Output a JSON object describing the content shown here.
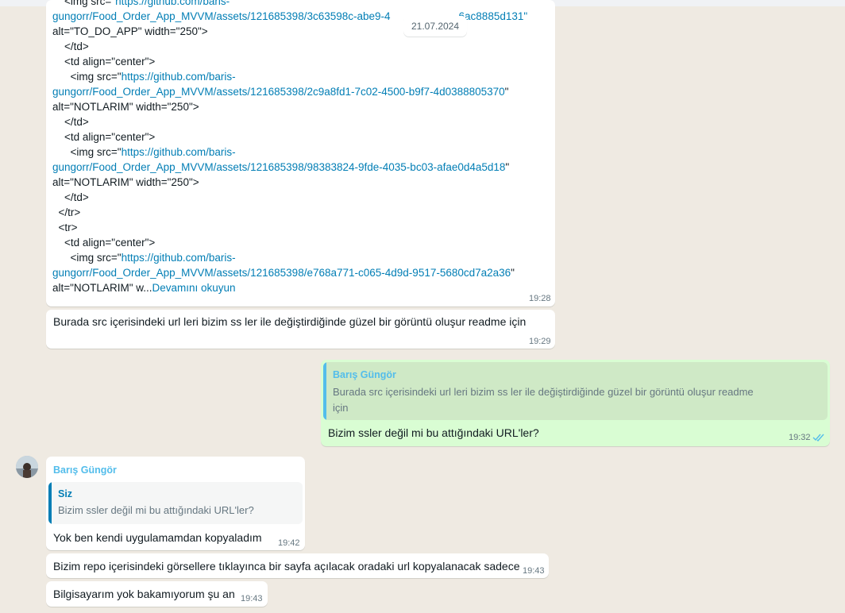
{
  "date_separator": "21.07.2024",
  "code_message": {
    "lines": [
      {
        "pre": "    <img src=\"",
        "link": "https://github.com/baris-",
        "post": ""
      },
      {
        "pre": "",
        "link": "gungorr/Food_Order_App_MVVM/assets/121685398/3c63598c-abe9-4",
        "post": "",
        "hidden_tail_link": "6ac8885d131\""
      },
      {
        "pre": "alt=\"TO_DO_APP\" width=\"250\">",
        "link": "",
        "post": ""
      },
      {
        "pre": "    </td>",
        "link": "",
        "post": ""
      },
      {
        "pre": "    <td align=\"center\">",
        "link": "",
        "post": ""
      },
      {
        "pre": "      <img src=\"",
        "link": "https://github.com/baris-",
        "post": ""
      },
      {
        "pre": "",
        "link": "gungorr/Food_Order_App_MVVM/assets/121685398/2c9a8fd1-7c02-4500-b9f7-4d0388805370",
        "post": "\""
      },
      {
        "pre": "alt=\"NOTLARIM\" width=\"250\">",
        "link": "",
        "post": ""
      },
      {
        "pre": "    </td>",
        "link": "",
        "post": ""
      },
      {
        "pre": "    <td align=\"center\">",
        "link": "",
        "post": ""
      },
      {
        "pre": "      <img src=\"",
        "link": "https://github.com/baris-",
        "post": ""
      },
      {
        "pre": "",
        "link": "gungorr/Food_Order_App_MVVM/assets/121685398/98383824-9fde-4035-bc03-afae0d4a5d18",
        "post": "\""
      },
      {
        "pre": "alt=\"NOTLARIM\" width=\"250\">",
        "link": "",
        "post": ""
      },
      {
        "pre": "    </td>",
        "link": "",
        "post": ""
      },
      {
        "pre": "  </tr>",
        "link": "",
        "post": ""
      },
      {
        "pre": "  <tr>",
        "link": "",
        "post": ""
      },
      {
        "pre": "    <td align=\"center\">",
        "link": "",
        "post": ""
      },
      {
        "pre": "      <img src=\"",
        "link": "https://github.com/baris-",
        "post": ""
      },
      {
        "pre": "",
        "link": "gungorr/Food_Order_App_MVVM/assets/121685398/e768a771-c065-4d9d-9517-5680cd7a2a36",
        "post": "\""
      },
      {
        "pre": "alt=\"NOTLARIM\" w...",
        "link": "",
        "post": ""
      }
    ],
    "read_more": "Devamını okuyun",
    "time": "19:28"
  },
  "msg_burada": {
    "text": "Burada src içerisindeki url leri bizim ss ler ile değiştirdiğinde güzel bir görüntü oluşur readme  için",
    "time": "19:29"
  },
  "reply_out": {
    "quote_author": "Barış Güngör",
    "quote_text_line1": "Burada src içerisindeki url leri bizim ss ler ile değiştirdiğinde güzel bir görüntü oluşur readme",
    "quote_text_line2": "için",
    "text": "Bizim ssler değil mi bu attığındaki URL'ler?",
    "time": "19:32"
  },
  "reply_in": {
    "sender": "Barış Güngör",
    "quote_author": "Siz",
    "quote_text": "Bizim ssler değil mi bu attığındaki URL'ler?",
    "text": "Yok ben kendi uygulamamdan kopyaladım",
    "time": "19:42"
  },
  "msg_repo": {
    "text": "Bizim repo içerisindeki görsellere tıklayınca bir sayfa açılacak oradaki url kopyalanacak sadece",
    "time": "19:43"
  },
  "msg_bilgisayar": {
    "text": "Bilgisayarım yok bakamıyorum şu an",
    "time": "19:43"
  },
  "colors": {
    "background": "#efeae2",
    "incoming": "#ffffff",
    "outgoing": "#d9fdd3",
    "link": "#027eb5",
    "quote_bar_in": "#06cf9c",
    "sender_name": "#53bdeb",
    "tick_read": "#53bdeb"
  },
  "icons": [
    "double-check-icon",
    "avatar"
  ]
}
